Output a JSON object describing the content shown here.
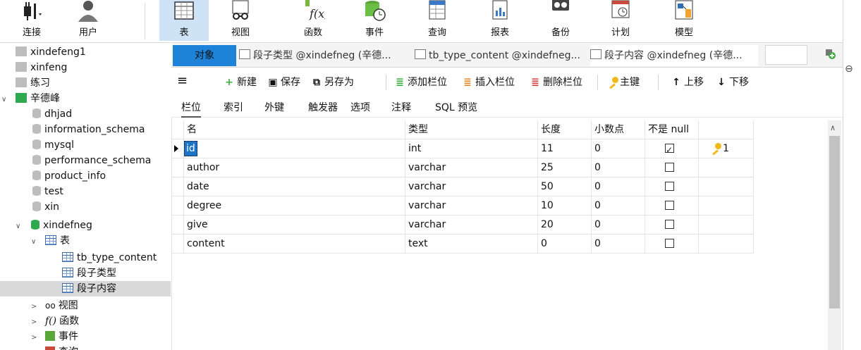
{
  "ribbon": {
    "buttons": [
      {
        "label": "连接",
        "icon": "plug-icon"
      },
      {
        "label": "用户",
        "icon": "user-icon"
      },
      {
        "label": "表",
        "icon": "table-icon"
      },
      {
        "label": "视图",
        "icon": "view-glasses-icon"
      },
      {
        "label": "函数",
        "icon": "function-icon"
      },
      {
        "label": "事件",
        "icon": "event-clock-icon"
      },
      {
        "label": "查询",
        "icon": "query-icon"
      },
      {
        "label": "报表",
        "icon": "report-icon"
      },
      {
        "label": "备份",
        "icon": "backup-icon"
      },
      {
        "label": "计划",
        "icon": "schedule-icon"
      },
      {
        "label": "模型",
        "icon": "model-icon"
      }
    ],
    "active": "表"
  },
  "tree": {
    "items": [
      {
        "label": "xindefeng1",
        "icon": "connection-icon"
      },
      {
        "label": "xinfeng",
        "icon": "connection-icon"
      },
      {
        "label": "练习",
        "icon": "connection-icon"
      },
      {
        "label": "辛德峰",
        "icon": "connection-open-icon"
      },
      {
        "label": "dhjad",
        "icon": "database-icon"
      },
      {
        "label": "information_schema",
        "icon": "database-icon"
      },
      {
        "label": "mysql",
        "icon": "database-icon"
      },
      {
        "label": "performance_schema",
        "icon": "database-icon"
      },
      {
        "label": "product_info",
        "icon": "database-icon"
      },
      {
        "label": "test",
        "icon": "database-icon"
      },
      {
        "label": "xin",
        "icon": "database-icon"
      },
      {
        "label": "xindefneg",
        "icon": "database-open-icon"
      },
      {
        "label": "表",
        "icon": "table-folder-icon"
      },
      {
        "label": "tb_type_content",
        "icon": "table-icon"
      },
      {
        "label": "段子类型",
        "icon": "table-icon"
      },
      {
        "label": "段子内容",
        "icon": "table-icon"
      },
      {
        "label": "视图",
        "icon": "view-icon"
      },
      {
        "label": "函数",
        "icon": "function-icon"
      },
      {
        "label": "事件",
        "icon": "event-icon"
      },
      {
        "label": "查询",
        "icon": "query-icon"
      }
    ],
    "selected": "段子内容"
  },
  "tabs": {
    "object_label": "对象",
    "items": [
      "段子类型 @xindefneg (辛德...",
      "tb_type_content @xindefneg...",
      "段子内容 @xindefneg (辛德..."
    ]
  },
  "toolbar": {
    "menu": "≡",
    "new": "新建",
    "save": "保存",
    "save_as": "另存为",
    "add_field": "添加栏位",
    "insert_field": "插入栏位",
    "delete_field": "删除栏位",
    "primary_key": "主键",
    "move_up": "上移",
    "move_down": "下移"
  },
  "subtabs": [
    "栏位",
    "索引",
    "外键",
    "触发器",
    "选项",
    "注释",
    "SQL 预览"
  ],
  "grid": {
    "columns": [
      "名",
      "类型",
      "长度",
      "小数点",
      "不是 null",
      ""
    ],
    "rows": [
      {
        "name": "id",
        "type": "int",
        "length": "11",
        "decimals": "0",
        "not_null": true,
        "key": "1"
      },
      {
        "name": "author",
        "type": "varchar",
        "length": "25",
        "decimals": "0",
        "not_null": false,
        "key": ""
      },
      {
        "name": "date",
        "type": "varchar",
        "length": "50",
        "decimals": "0",
        "not_null": false,
        "key": ""
      },
      {
        "name": "degree",
        "type": "varchar",
        "length": "10",
        "decimals": "0",
        "not_null": false,
        "key": ""
      },
      {
        "name": "give",
        "type": "varchar",
        "length": "20",
        "decimals": "0",
        "not_null": false,
        "key": ""
      },
      {
        "name": "content",
        "type": "text",
        "length": "0",
        "decimals": "0",
        "not_null": false,
        "key": ""
      }
    ]
  }
}
